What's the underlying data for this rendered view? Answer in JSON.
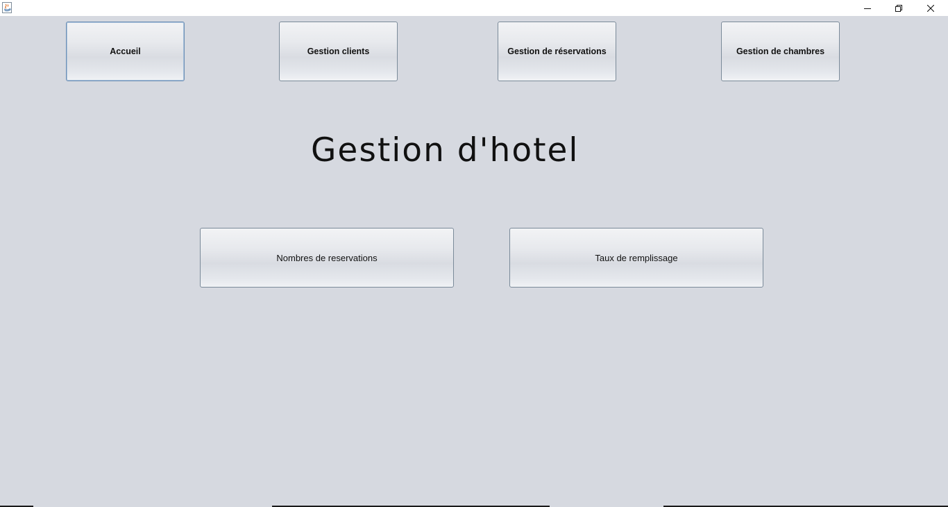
{
  "window": {
    "app_icon": "java-icon",
    "controls": {
      "minimize_icon": "minimize-icon",
      "maximize_icon": "restore-icon",
      "close_icon": "close-icon"
    }
  },
  "nav": {
    "accueil": "Accueil",
    "gestion_clients": "Gestion clients",
    "gestion_reservations": "Gestion de réservations",
    "gestion_chambres": "Gestion de chambres"
  },
  "main": {
    "title": "Gestion d'hotel",
    "nombres_reservations": "Nombres de reservations",
    "taux_remplissage": "Taux de remplissage"
  },
  "colors": {
    "background": "#d6d9e0",
    "titlebar": "#ffffff",
    "focus_border": "#6d8fb5"
  }
}
